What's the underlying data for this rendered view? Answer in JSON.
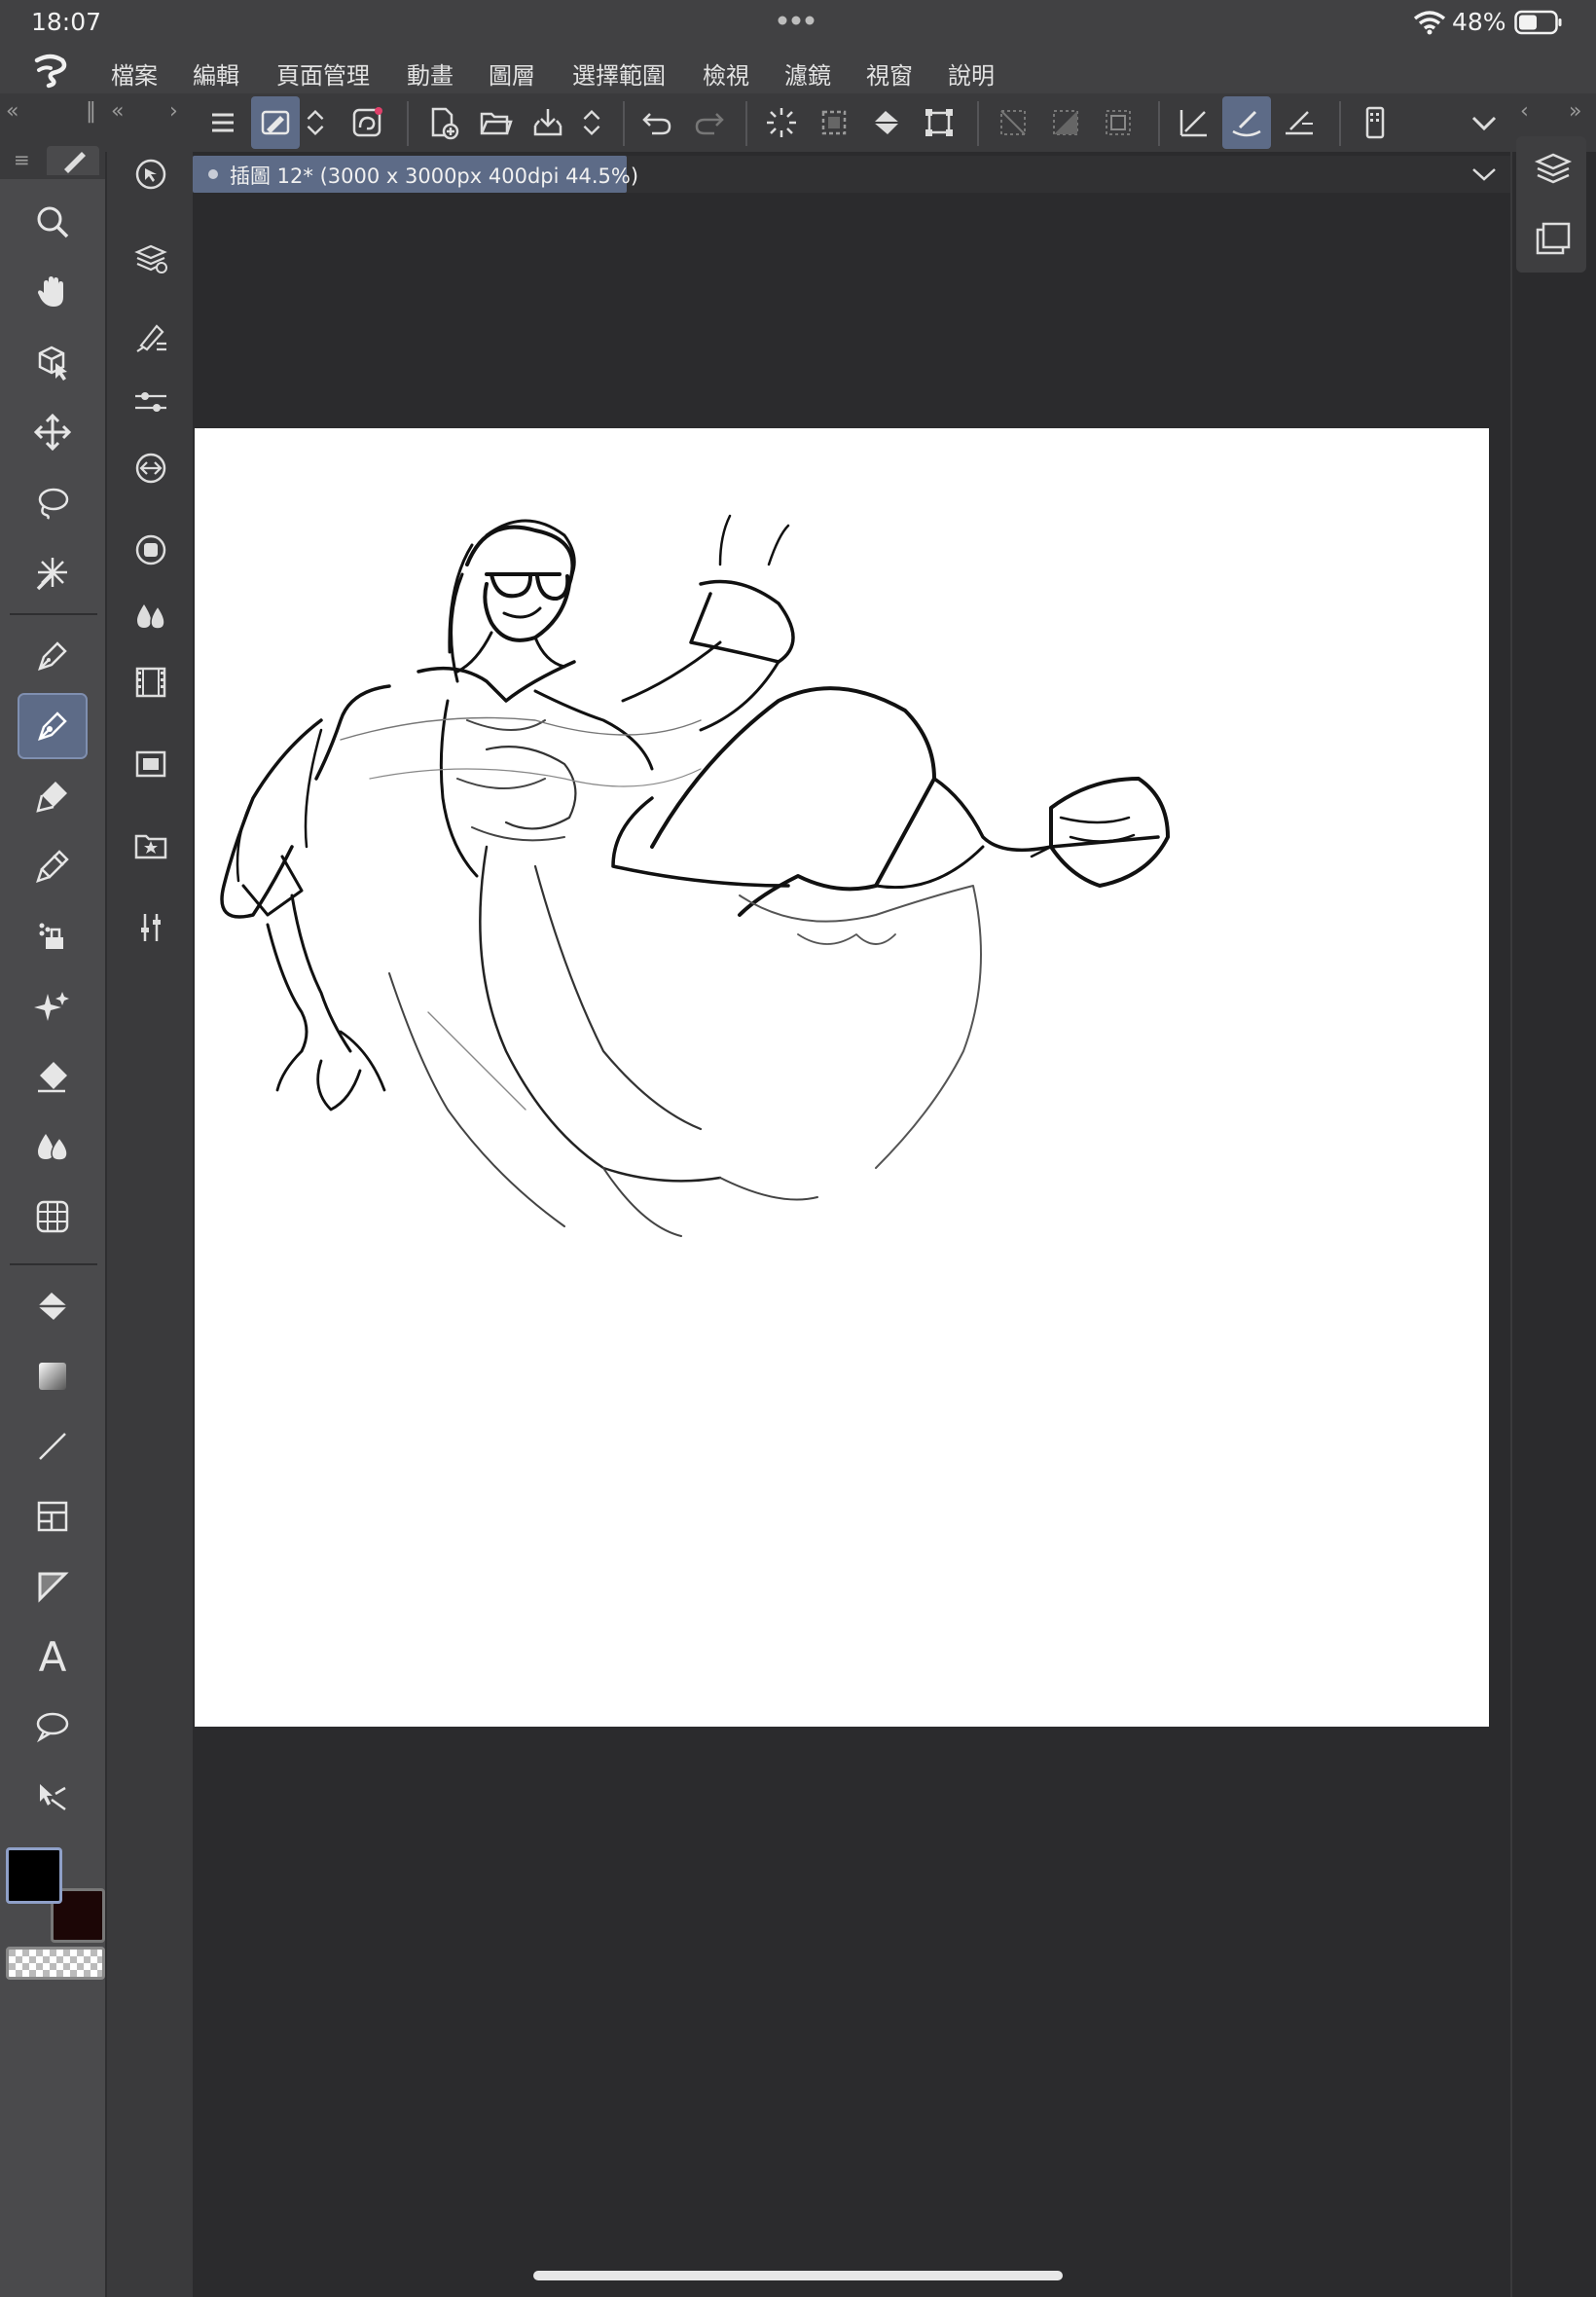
{
  "status": {
    "time": "18:07",
    "battery_pct": "48%"
  },
  "menu": [
    "檔案",
    "編輯",
    "頁面管理",
    "動畫",
    "圖層",
    "選擇範圍",
    "檢視",
    "濾鏡",
    "視窗",
    "說明"
  ],
  "document_tab": {
    "title": "插圖 12* (3000 x 3000px 400dpi 44.5%)"
  },
  "tools": [
    {
      "name": "zoom-icon"
    },
    {
      "name": "hand-icon"
    },
    {
      "name": "object-select-icon"
    },
    {
      "name": "move-icon"
    },
    {
      "name": "lasso-select-icon"
    },
    {
      "name": "auto-select-icon"
    },
    {
      "name": "pen-icon"
    },
    {
      "name": "pencil-icon"
    },
    {
      "name": "brush-icon"
    },
    {
      "name": "airbrush-icon"
    },
    {
      "name": "decoration-icon"
    },
    {
      "name": "sparkle-icon"
    },
    {
      "name": "eraser-icon"
    },
    {
      "name": "blend-icon"
    },
    {
      "name": "figure-ruler-icon"
    },
    {
      "name": "fill-icon"
    },
    {
      "name": "gradient-icon"
    },
    {
      "name": "line-icon"
    },
    {
      "name": "frame-icon"
    },
    {
      "name": "ruler-icon"
    },
    {
      "name": "text-icon"
    },
    {
      "name": "balloon-icon"
    },
    {
      "name": "correct-line-icon"
    }
  ],
  "colors": {
    "main": "#000000",
    "sub": "#1c0606",
    "accent": "#5d6b87"
  },
  "icons": {
    "text_tool_glyph": "A"
  }
}
